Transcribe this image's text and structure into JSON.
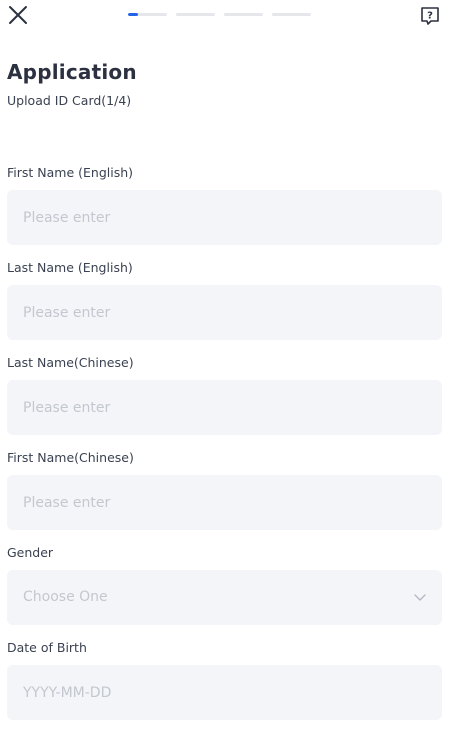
{
  "header": {
    "close_icon": "close-icon",
    "help_icon": "question-bubble-icon",
    "progress": {
      "steps_total": 4,
      "current_step": 1,
      "current_step_fraction": 0.25
    },
    "accent_color": "#2563eb"
  },
  "page": {
    "title": "Application",
    "subtitle": "Upload ID Card(1/4)"
  },
  "form": {
    "first_name_en": {
      "label": "First Name (English)",
      "placeholder": "Please enter",
      "value": ""
    },
    "last_name_en": {
      "label": "Last Name (English)",
      "placeholder": "Please enter",
      "value": ""
    },
    "last_name_zh": {
      "label": "Last Name(Chinese)",
      "placeholder": "Please enter",
      "value": ""
    },
    "first_name_zh": {
      "label": "First Name(Chinese)",
      "placeholder": "Please enter",
      "value": ""
    },
    "gender": {
      "label": "Gender",
      "placeholder": "Choose One",
      "icon": "chevron-down-icon"
    },
    "dob": {
      "label": "Date of Birth",
      "placeholder": "YYYY-MM-DD",
      "value": ""
    }
  }
}
